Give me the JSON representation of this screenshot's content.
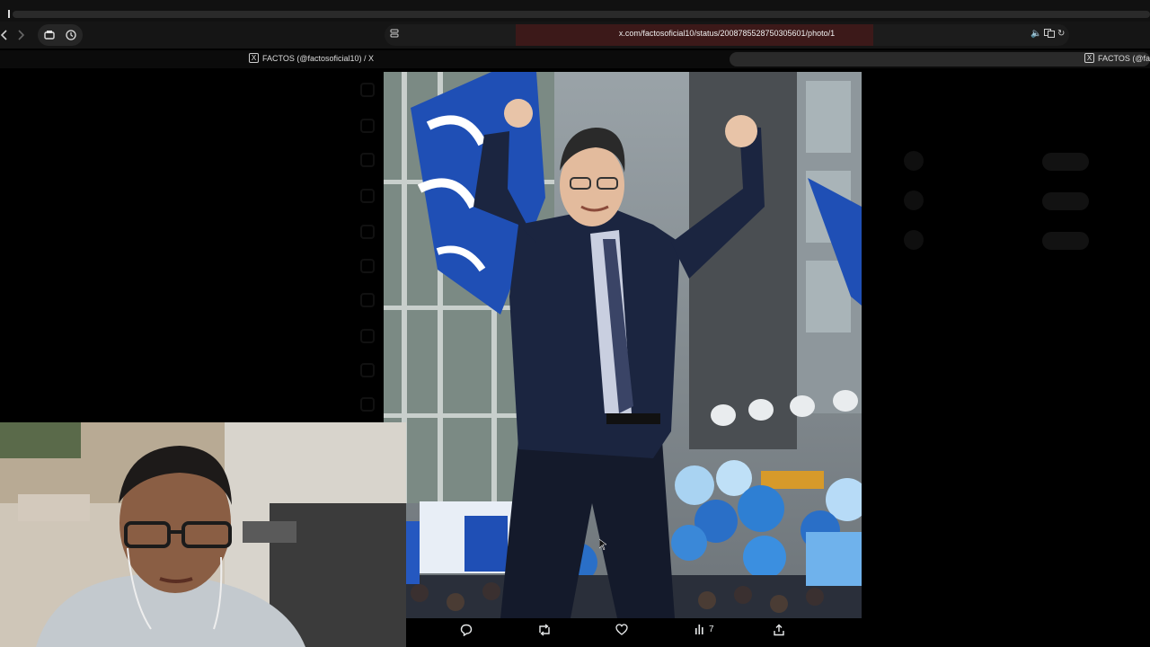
{
  "browser": {
    "url": "x.com/factosoficial10/status/2008785528750305601/photo/1",
    "tabs": [
      {
        "label": "FACTOS (@factosoficial10) / X"
      },
      {
        "label": "FACTOS (@fac"
      }
    ]
  },
  "post": {
    "actions": {
      "views_count": "7"
    }
  },
  "colors": {
    "accent": "#1d9bf0",
    "background": "#000000",
    "toolbar": "#151515"
  }
}
